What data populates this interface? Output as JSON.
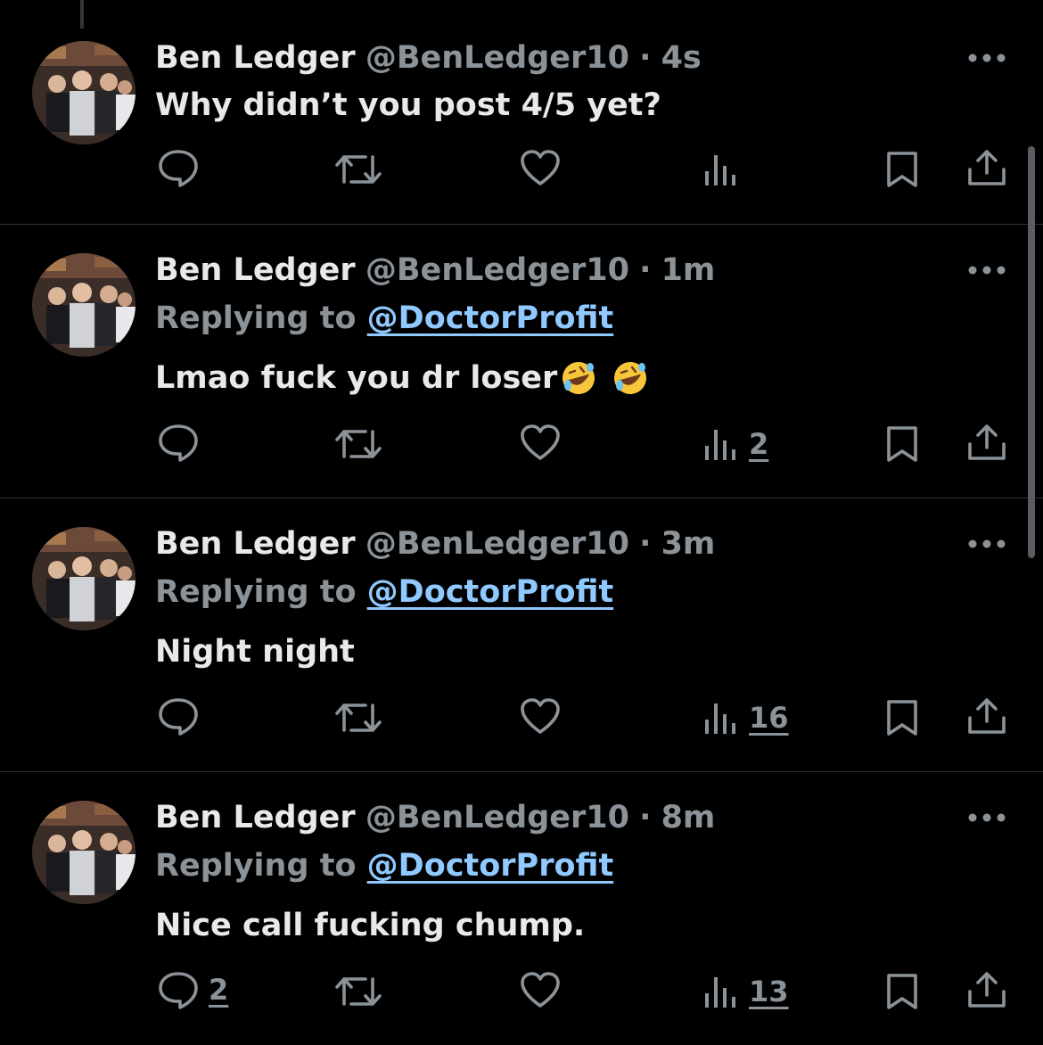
{
  "tweets": [
    {
      "author_name": "Ben Ledger",
      "author_handle": "@BenLedger10",
      "separator": "·",
      "timestamp": "4s",
      "replying_prefix": "",
      "replying_to": "",
      "text": "Why didn’t you post 4/5 yet?",
      "reply_count": "",
      "view_count": ""
    },
    {
      "author_name": "Ben Ledger",
      "author_handle": "@BenLedger10",
      "separator": "·",
      "timestamp": "1m",
      "replying_prefix": "Replying to",
      "replying_to": "@DoctorProfit",
      "text": "Lmao fuck you dr loser",
      "reply_count": "",
      "view_count": "2"
    },
    {
      "author_name": "Ben Ledger",
      "author_handle": "@BenLedger10",
      "separator": "·",
      "timestamp": "3m",
      "replying_prefix": "Replying to",
      "replying_to": "@DoctorProfit",
      "text": "Night night",
      "reply_count": "",
      "view_count": "16"
    },
    {
      "author_name": "Ben Ledger",
      "author_handle": "@BenLedger10",
      "separator": "·",
      "timestamp": "8m",
      "replying_prefix": "Replying to",
      "replying_to": "@DoctorProfit",
      "text": "Nice call fucking chump.",
      "reply_count": "2",
      "view_count": "13"
    }
  ],
  "emoji": [
    "rolling-on-floor-laughing-icon",
    "rolling-on-floor-laughing-icon"
  ],
  "icons": {
    "reply": "reply-icon",
    "repost": "repost-icon",
    "like": "like-icon",
    "views": "views-icon",
    "bookmark": "bookmark-icon",
    "share": "share-icon",
    "more": "more-icon"
  },
  "colors": {
    "background": "#000000",
    "text_primary": "#e7e9ea",
    "text_secondary": "#8b9298",
    "link": "#8fc9ff",
    "divider": "#2f3336"
  }
}
